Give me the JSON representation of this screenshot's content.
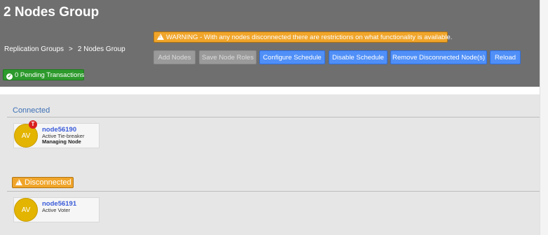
{
  "page": {
    "title": "2 Nodes Group"
  },
  "breadcrumb": {
    "parent": "Replication Groups",
    "separator": ">",
    "current": "2 Nodes Group"
  },
  "warning": {
    "text": "WARNING - With any nodes disconnected there are restrictions on what functionality is available."
  },
  "toolbar": {
    "add_nodes": "Add Nodes",
    "save_node_roles": "Save Node Roles",
    "configure_schedule": "Configure Schedule",
    "disable_schedule": "Disable Schedule",
    "remove_disconnected": "Remove Disconnected Node(s)",
    "reload": "Reload"
  },
  "pending": {
    "label": "0 Pending Transactions"
  },
  "sections": {
    "connected": {
      "label": "Connected",
      "node": {
        "avatar": "AV",
        "badge": "T",
        "name": "node56190",
        "role": "Active Tie-breaker",
        "sub": "Managing Node"
      }
    },
    "disconnected": {
      "label": "Disconnected",
      "node": {
        "avatar": "AV",
        "name": "node56191",
        "role": "Active Voter"
      }
    }
  },
  "colors": {
    "header_bg": "#6f6f6f",
    "warning": "#f0a52a",
    "primary": "#4f8ff7",
    "success": "#2c9a2c",
    "avatar": "#e3b400",
    "badge": "#d92020",
    "link": "#3a5bd9"
  },
  "icons": {
    "warning": "warning-triangle-icon",
    "pending": "check-circle-icon"
  }
}
